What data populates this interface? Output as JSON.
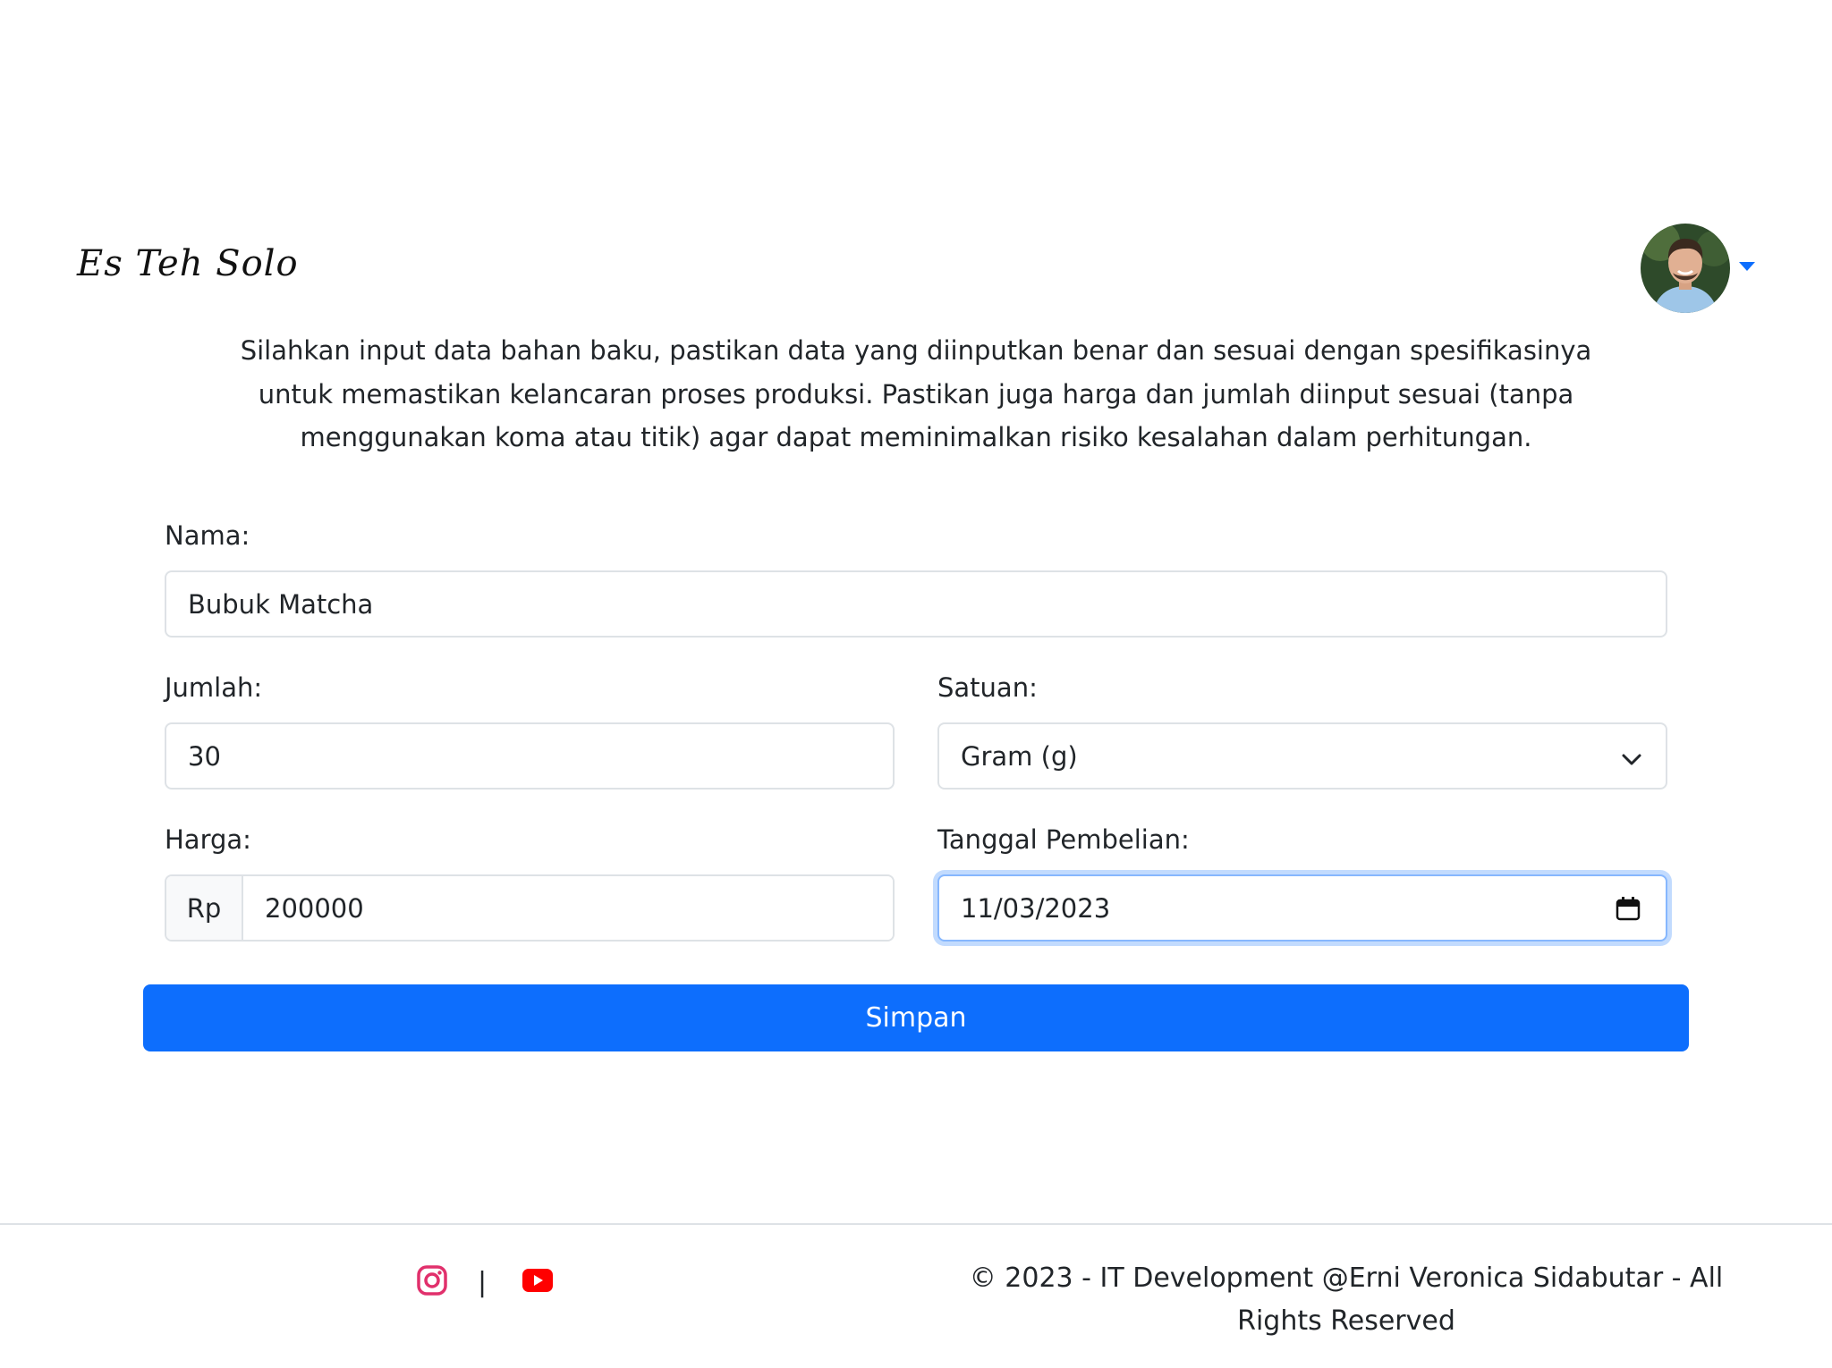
{
  "header": {
    "brand": "Es Teh Solo",
    "avatar_icon": "user-avatar",
    "caret_icon": "caret-down-icon",
    "accent_color": "#0d6efd"
  },
  "intro": {
    "text": "Silahkan input data bahan baku, pastikan data yang diinputkan benar dan sesuai dengan spesifikasinya untuk memastikan kelancaran proses produksi. Pastikan juga harga dan jumlah diinput sesuai (tanpa menggunakan koma atau titik) agar dapat meminimalkan risiko kesalahan dalam perhitungan."
  },
  "form": {
    "nama": {
      "label": "Nama:",
      "value": "Bubuk Matcha"
    },
    "jumlah": {
      "label": "Jumlah:",
      "value": "30"
    },
    "satuan": {
      "label": "Satuan:",
      "value": "Gram (g)",
      "icon": "chevron-down-icon"
    },
    "harga": {
      "label": "Harga:",
      "prefix": "Rp",
      "value": "200000"
    },
    "tanggal": {
      "label": "Tanggal Pembelian:",
      "value": "11/03/2023",
      "icon": "calendar-icon"
    },
    "submit_label": "Simpan"
  },
  "footer": {
    "instagram_icon": "instagram-icon",
    "separator": "|",
    "youtube_icon": "youtube-icon",
    "copyright": "© 2023 - IT Development @Erni Veronica Sidabutar - All Rights Reserved"
  }
}
